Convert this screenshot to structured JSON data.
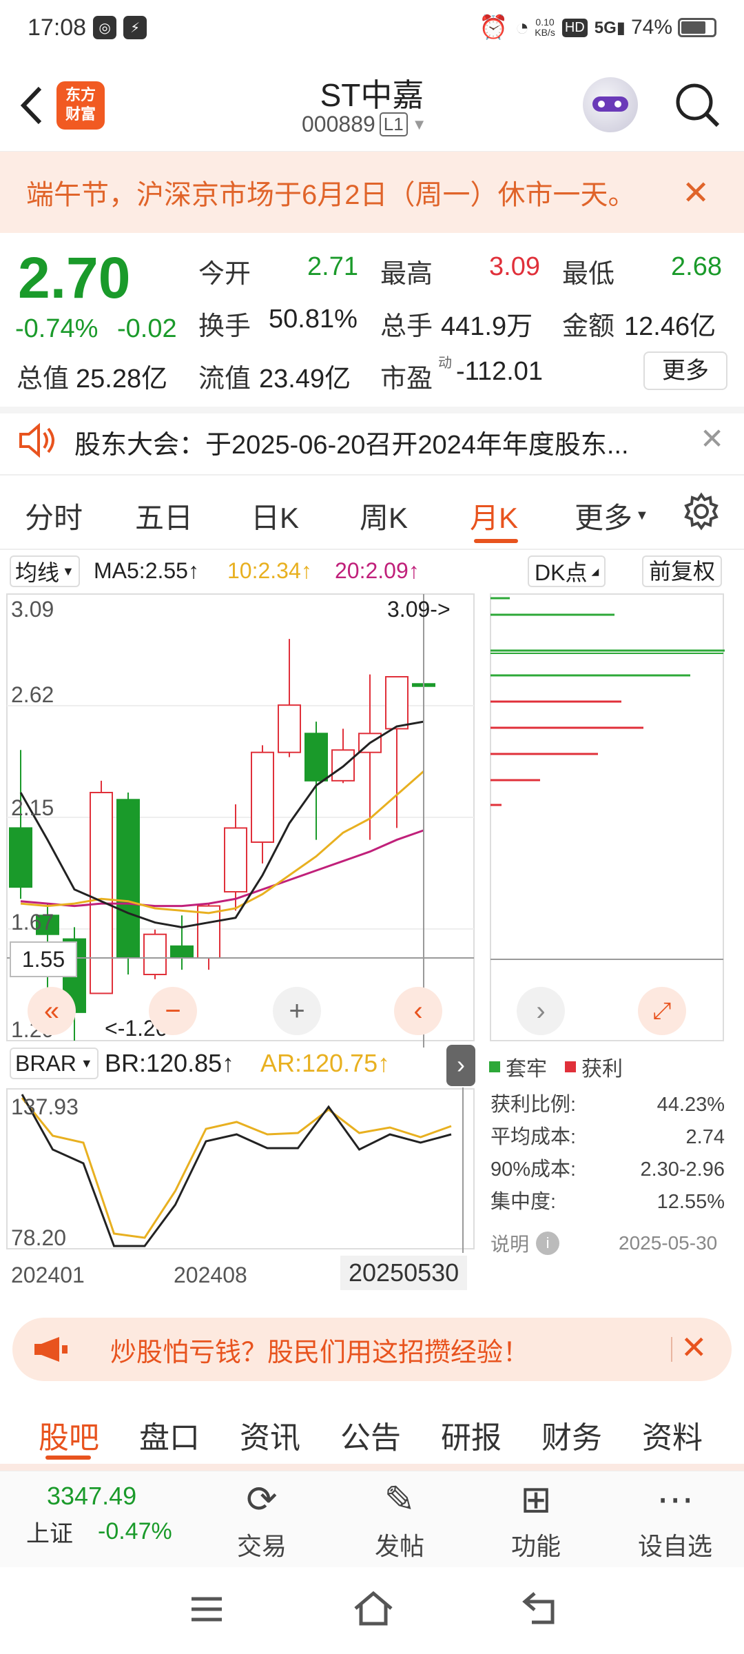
{
  "status_bar": {
    "time": "17:08",
    "net_speed_top": "0.10",
    "net_speed_unit": "KB/s",
    "battery": "74%"
  },
  "header": {
    "logo": "东方财富",
    "title": "ST中嘉",
    "code": "000889",
    "level_badge": "L1"
  },
  "notice": {
    "text": "端午节，沪深京市场于6月2日（周一）休市一天。"
  },
  "quote": {
    "price": "2.70",
    "change_pct": "-0.74%",
    "change": "-0.02",
    "open_label": "今开",
    "open": "2.71",
    "high_label": "最高",
    "high": "3.09",
    "low_label": "最低",
    "low": "2.68",
    "turnover_label": "换手",
    "turnover": "50.81%",
    "volume_label": "总手",
    "volume": "441.9万",
    "amount_label": "金额",
    "amount": "12.46亿",
    "mktcap_label": "总值",
    "mktcap": "25.28亿",
    "float_label": "流值",
    "float_cap": "23.49亿",
    "pe_label": "市盈",
    "pe_sup": "动",
    "pe": "-112.01",
    "more": "更多"
  },
  "announcement": {
    "text": "股东大会：于2025-06-20召开2024年年度股东..."
  },
  "kline_tabs": [
    "分时",
    "五日",
    "日K",
    "周K",
    "月K",
    "更多"
  ],
  "chart_toolbar": {
    "ma_select": "均线",
    "ma5": "MA5:2.55",
    "ma10": "10:2.34",
    "ma20": "20:2.09",
    "dk": "DK点",
    "adjust": "前复权"
  },
  "chart_data": {
    "type": "candlestick",
    "x_labels": [
      "202401",
      "202408",
      "20250530"
    ],
    "y_ticks": [
      "3.09",
      "2.62",
      "2.15",
      "1.67",
      "1.20"
    ],
    "ylim": [
      1.2,
      3.09
    ],
    "max_marker": "3.09->",
    "min_marker": "<-1.20",
    "crosshair_value": "1.55",
    "candles": [
      {
        "o": 2.1,
        "c": 1.85,
        "h": 2.43,
        "l": 1.8
      },
      {
        "o": 1.73,
        "c": 1.65,
        "h": 1.78,
        "l": 1.38
      },
      {
        "o": 1.63,
        "c": 1.32,
        "h": 1.68,
        "l": 1.2
      },
      {
        "o": 1.4,
        "c": 2.25,
        "h": 2.3,
        "l": 1.4
      },
      {
        "o": 2.22,
        "c": 1.55,
        "h": 2.25,
        "l": 1.48
      },
      {
        "o": 1.48,
        "c": 1.65,
        "h": 1.67,
        "l": 1.46
      },
      {
        "o": 1.6,
        "c": 1.55,
        "h": 1.73,
        "l": 1.5
      },
      {
        "o": 1.55,
        "c": 1.77,
        "h": 1.78,
        "l": 1.5
      },
      {
        "o": 1.83,
        "c": 2.1,
        "h": 2.2,
        "l": 1.75
      },
      {
        "o": 2.04,
        "c": 2.42,
        "h": 2.45,
        "l": 1.95
      },
      {
        "o": 2.42,
        "c": 2.62,
        "h": 2.9,
        "l": 2.4
      },
      {
        "o": 2.5,
        "c": 2.3,
        "h": 2.55,
        "l": 2.05
      },
      {
        "o": 2.3,
        "c": 2.43,
        "h": 2.52,
        "l": 2.29
      },
      {
        "o": 2.42,
        "c": 2.5,
        "h": 2.75,
        "l": 2.05
      },
      {
        "o": 2.52,
        "c": 2.74,
        "h": 2.74,
        "l": 2.1
      },
      {
        "o": 2.71,
        "c": 2.7,
        "h": 3.09,
        "l": 2.68
      }
    ],
    "ma5": [
      2.25,
      2.05,
      1.84,
      1.79,
      1.74,
      1.7,
      1.68,
      1.7,
      1.72,
      1.9,
      2.12,
      2.28,
      2.36,
      2.46,
      2.53,
      2.55
    ],
    "ma10": [
      1.78,
      1.77,
      1.78,
      1.8,
      1.79,
      1.76,
      1.75,
      1.74,
      1.76,
      1.82,
      1.9,
      1.98,
      2.08,
      2.14,
      2.24,
      2.34
    ],
    "ma20": [
      1.79,
      1.78,
      1.77,
      1.78,
      1.78,
      1.77,
      1.77,
      1.78,
      1.8,
      1.84,
      1.88,
      1.92,
      1.96,
      2.0,
      2.05,
      2.09
    ]
  },
  "brar": {
    "select": "BRAR",
    "br": "BR:120.85",
    "ar": "AR:120.75",
    "top": "137.93",
    "bottom": "78.20"
  },
  "cost_panel": {
    "legend_locked": "套牢",
    "legend_profit": "获利",
    "rows": [
      {
        "label": "获利比例:",
        "value": "44.23%"
      },
      {
        "label": "平均成本:",
        "value": "2.74"
      },
      {
        "label": "90%成本:",
        "value": "2.30-2.96"
      },
      {
        "label": "集中度:",
        "value": "12.55%"
      }
    ],
    "note": "说明",
    "date": "2025-05-30"
  },
  "ad": {
    "text": "炒股怕亏钱？股民们用这招攒经验！"
  },
  "section_tabs": [
    "股吧",
    "盘口",
    "资讯",
    "公告",
    "研报",
    "财务",
    "资料"
  ],
  "index": {
    "value": "3347.49",
    "name": "上证",
    "change": "-0.47%"
  },
  "toolbar": {
    "trade": "交易",
    "post": "发帖",
    "features": "功能",
    "watch": "设自选"
  },
  "colors": {
    "accent": "#e8531e",
    "up": "#e0303a",
    "down": "#1a9a2a",
    "ma5": "#222222",
    "ma10": "#e8b020",
    "ma20": "#c0207a"
  }
}
